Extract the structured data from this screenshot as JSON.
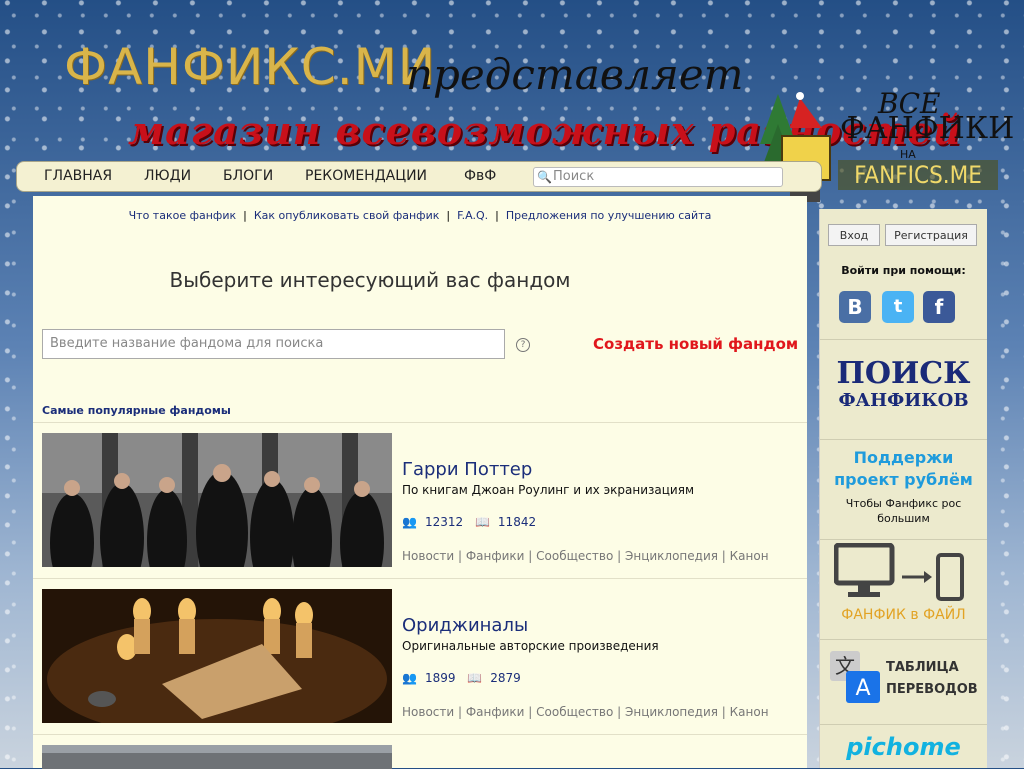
{
  "header": {
    "brand": "ФАНФИКС.МИ",
    "brand_sub": "представляет",
    "slogan": "магазин всевозможных разностей",
    "promo": {
      "line1": "ВСЕ",
      "line2": "ФАНФИКИ",
      "line3": "НА",
      "line4": "FANFICS.ME"
    }
  },
  "nav": {
    "items": [
      "ГЛАВНАЯ",
      "ЛЮДИ",
      "БЛОГИ",
      "РЕКОМЕНДАЦИИ",
      "ФвФ"
    ],
    "search_placeholder": "Поиск"
  },
  "info_links": [
    "Что такое фанфик",
    "Как опубликовать свой фанфик",
    "F.A.Q.",
    "Предложения по улучшению сайта"
  ],
  "main": {
    "heading": "Выберите интересующий вас фандом",
    "fandom_search_placeholder": "Введите название фандома для поиска",
    "help": "?",
    "create_label": "Создать новый фандом",
    "popular_label": "Самые популярные фандомы"
  },
  "fandoms": [
    {
      "title": "Гарри Поттер",
      "description": "По книгам Джоан Роулинг и их экранизациям",
      "people": "12312",
      "fics": "11842",
      "links": [
        "Новости",
        "Фанфики",
        "Сообщество",
        "Энциклопедия",
        "Канон"
      ]
    },
    {
      "title": "Ориджиналы",
      "description": "Оригинальные авторские произведения",
      "people": "1899",
      "fics": "2879",
      "links": [
        "Новости",
        "Фанфики",
        "Сообщество",
        "Энциклопедия",
        "Канон"
      ]
    }
  ],
  "sidebar": {
    "login": "Вход",
    "register": "Регистрация",
    "login_via": "Войти при помощи:",
    "social": [
      "В",
      "t",
      "f"
    ],
    "poisk_line1": "ПОИСК",
    "poisk_line2": "ФАНФИКОВ",
    "support_line1": "Поддержи",
    "support_line2": "проект рублём",
    "support_sub1": "Чтобы Фанфикс рос",
    "support_sub2": "большим",
    "file_label": "ФАНФИК в ФАЙЛ",
    "table_line1": "ТАБЛИЦА",
    "table_line2": "ПЕРЕВОДОВ",
    "pichome": "pichome"
  },
  "colors": {
    "accent": "#1b2e7a",
    "create": "#e0171c",
    "support": "#1f9bdc",
    "file": "#e2a324"
  }
}
